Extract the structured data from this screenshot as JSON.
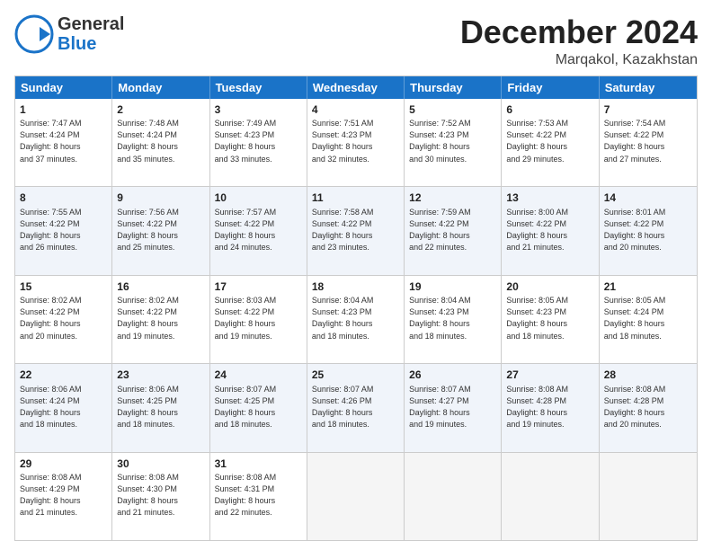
{
  "logo": {
    "line1": "General",
    "line2": "Blue"
  },
  "header": {
    "month": "December 2024",
    "location": "Marqakol, Kazakhstan"
  },
  "weekdays": [
    "Sunday",
    "Monday",
    "Tuesday",
    "Wednesday",
    "Thursday",
    "Friday",
    "Saturday"
  ],
  "rows": [
    {
      "alt": false,
      "cells": [
        {
          "day": "1",
          "lines": [
            "Sunrise: 7:47 AM",
            "Sunset: 4:24 PM",
            "Daylight: 8 hours",
            "and 37 minutes."
          ]
        },
        {
          "day": "2",
          "lines": [
            "Sunrise: 7:48 AM",
            "Sunset: 4:24 PM",
            "Daylight: 8 hours",
            "and 35 minutes."
          ]
        },
        {
          "day": "3",
          "lines": [
            "Sunrise: 7:49 AM",
            "Sunset: 4:23 PM",
            "Daylight: 8 hours",
            "and 33 minutes."
          ]
        },
        {
          "day": "4",
          "lines": [
            "Sunrise: 7:51 AM",
            "Sunset: 4:23 PM",
            "Daylight: 8 hours",
            "and 32 minutes."
          ]
        },
        {
          "day": "5",
          "lines": [
            "Sunrise: 7:52 AM",
            "Sunset: 4:23 PM",
            "Daylight: 8 hours",
            "and 30 minutes."
          ]
        },
        {
          "day": "6",
          "lines": [
            "Sunrise: 7:53 AM",
            "Sunset: 4:22 PM",
            "Daylight: 8 hours",
            "and 29 minutes."
          ]
        },
        {
          "day": "7",
          "lines": [
            "Sunrise: 7:54 AM",
            "Sunset: 4:22 PM",
            "Daylight: 8 hours",
            "and 27 minutes."
          ]
        }
      ]
    },
    {
      "alt": true,
      "cells": [
        {
          "day": "8",
          "lines": [
            "Sunrise: 7:55 AM",
            "Sunset: 4:22 PM",
            "Daylight: 8 hours",
            "and 26 minutes."
          ]
        },
        {
          "day": "9",
          "lines": [
            "Sunrise: 7:56 AM",
            "Sunset: 4:22 PM",
            "Daylight: 8 hours",
            "and 25 minutes."
          ]
        },
        {
          "day": "10",
          "lines": [
            "Sunrise: 7:57 AM",
            "Sunset: 4:22 PM",
            "Daylight: 8 hours",
            "and 24 minutes."
          ]
        },
        {
          "day": "11",
          "lines": [
            "Sunrise: 7:58 AM",
            "Sunset: 4:22 PM",
            "Daylight: 8 hours",
            "and 23 minutes."
          ]
        },
        {
          "day": "12",
          "lines": [
            "Sunrise: 7:59 AM",
            "Sunset: 4:22 PM",
            "Daylight: 8 hours",
            "and 22 minutes."
          ]
        },
        {
          "day": "13",
          "lines": [
            "Sunrise: 8:00 AM",
            "Sunset: 4:22 PM",
            "Daylight: 8 hours",
            "and 21 minutes."
          ]
        },
        {
          "day": "14",
          "lines": [
            "Sunrise: 8:01 AM",
            "Sunset: 4:22 PM",
            "Daylight: 8 hours",
            "and 20 minutes."
          ]
        }
      ]
    },
    {
      "alt": false,
      "cells": [
        {
          "day": "15",
          "lines": [
            "Sunrise: 8:02 AM",
            "Sunset: 4:22 PM",
            "Daylight: 8 hours",
            "and 20 minutes."
          ]
        },
        {
          "day": "16",
          "lines": [
            "Sunrise: 8:02 AM",
            "Sunset: 4:22 PM",
            "Daylight: 8 hours",
            "and 19 minutes."
          ]
        },
        {
          "day": "17",
          "lines": [
            "Sunrise: 8:03 AM",
            "Sunset: 4:22 PM",
            "Daylight: 8 hours",
            "and 19 minutes."
          ]
        },
        {
          "day": "18",
          "lines": [
            "Sunrise: 8:04 AM",
            "Sunset: 4:23 PM",
            "Daylight: 8 hours",
            "and 18 minutes."
          ]
        },
        {
          "day": "19",
          "lines": [
            "Sunrise: 8:04 AM",
            "Sunset: 4:23 PM",
            "Daylight: 8 hours",
            "and 18 minutes."
          ]
        },
        {
          "day": "20",
          "lines": [
            "Sunrise: 8:05 AM",
            "Sunset: 4:23 PM",
            "Daylight: 8 hours",
            "and 18 minutes."
          ]
        },
        {
          "day": "21",
          "lines": [
            "Sunrise: 8:05 AM",
            "Sunset: 4:24 PM",
            "Daylight: 8 hours",
            "and 18 minutes."
          ]
        }
      ]
    },
    {
      "alt": true,
      "cells": [
        {
          "day": "22",
          "lines": [
            "Sunrise: 8:06 AM",
            "Sunset: 4:24 PM",
            "Daylight: 8 hours",
            "and 18 minutes."
          ]
        },
        {
          "day": "23",
          "lines": [
            "Sunrise: 8:06 AM",
            "Sunset: 4:25 PM",
            "Daylight: 8 hours",
            "and 18 minutes."
          ]
        },
        {
          "day": "24",
          "lines": [
            "Sunrise: 8:07 AM",
            "Sunset: 4:25 PM",
            "Daylight: 8 hours",
            "and 18 minutes."
          ]
        },
        {
          "day": "25",
          "lines": [
            "Sunrise: 8:07 AM",
            "Sunset: 4:26 PM",
            "Daylight: 8 hours",
            "and 18 minutes."
          ]
        },
        {
          "day": "26",
          "lines": [
            "Sunrise: 8:07 AM",
            "Sunset: 4:27 PM",
            "Daylight: 8 hours",
            "and 19 minutes."
          ]
        },
        {
          "day": "27",
          "lines": [
            "Sunrise: 8:08 AM",
            "Sunset: 4:28 PM",
            "Daylight: 8 hours",
            "and 19 minutes."
          ]
        },
        {
          "day": "28",
          "lines": [
            "Sunrise: 8:08 AM",
            "Sunset: 4:28 PM",
            "Daylight: 8 hours",
            "and 20 minutes."
          ]
        }
      ]
    },
    {
      "alt": false,
      "cells": [
        {
          "day": "29",
          "lines": [
            "Sunrise: 8:08 AM",
            "Sunset: 4:29 PM",
            "Daylight: 8 hours",
            "and 21 minutes."
          ]
        },
        {
          "day": "30",
          "lines": [
            "Sunrise: 8:08 AM",
            "Sunset: 4:30 PM",
            "Daylight: 8 hours",
            "and 21 minutes."
          ]
        },
        {
          "day": "31",
          "lines": [
            "Sunrise: 8:08 AM",
            "Sunset: 4:31 PM",
            "Daylight: 8 hours",
            "and 22 minutes."
          ]
        },
        {
          "day": "",
          "lines": []
        },
        {
          "day": "",
          "lines": []
        },
        {
          "day": "",
          "lines": []
        },
        {
          "day": "",
          "lines": []
        }
      ]
    }
  ]
}
